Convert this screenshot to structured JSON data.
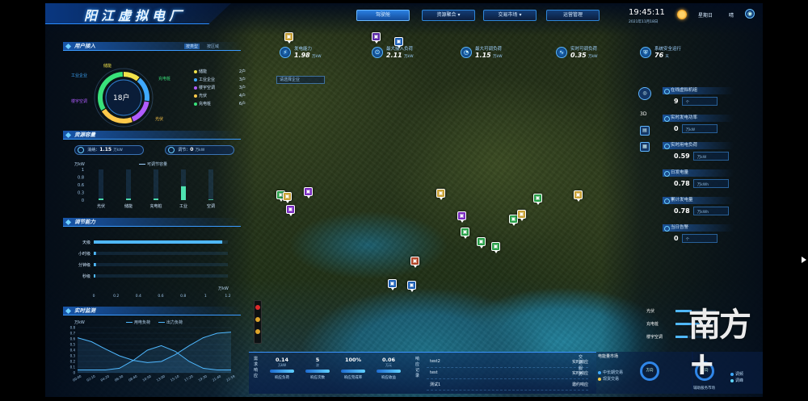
{
  "app": {
    "title": "阳江虚拟电厂"
  },
  "nav": {
    "items": [
      {
        "label": "驾驶舱",
        "active": true
      },
      {
        "label": "资源聚合 ▾",
        "active": false
      },
      {
        "label": "交易市场 ▾",
        "active": false
      },
      {
        "label": "运营管理",
        "active": false
      }
    ]
  },
  "header": {
    "time": "19:45:11",
    "date": "2021年11月18日",
    "weekday": "星期日",
    "weather": "晴",
    "weather_icon": "sun-icon",
    "user_icon": "user-icon"
  },
  "top_stats": [
    {
      "label": "发电能力",
      "value": "1.98",
      "unit": "万kW"
    },
    {
      "label": "最大接入负荷",
      "value": "2.11",
      "unit": "万kW"
    },
    {
      "label": "最大可调负荷",
      "value": "1.15",
      "unit": "万kW"
    },
    {
      "label": "实时可调负荷",
      "value": "0.35",
      "unit": "万kW"
    },
    {
      "label": "系统安全运行",
      "value": "76",
      "unit": "天"
    }
  ],
  "map_filter": {
    "placeholder": "请选择企业"
  },
  "users": {
    "title": "用户接入",
    "type_label": "按类型",
    "region_label": "按区域",
    "total": "18户",
    "ring_labels": {
      "storage": "储能",
      "industry": "工业企业",
      "charging": "充电桩",
      "hvac": "楼宇空调",
      "pv": "光伏"
    },
    "legend": [
      {
        "name": "储能",
        "count": "2户",
        "color": "#f0e24a"
      },
      {
        "name": "工业企业",
        "count": "3户",
        "color": "#3fa9ff"
      },
      {
        "name": "楼宇空调",
        "count": "3户",
        "color": "#b05cff"
      },
      {
        "name": "光伏",
        "count": "4户",
        "color": "#ffc94a"
      },
      {
        "name": "充电桩",
        "count": "6户",
        "color": "#39e27a"
      }
    ]
  },
  "resource": {
    "title": "资源容量",
    "gen_label": "消纳：",
    "gen_value": "1.15",
    "gen_unit": "万kW",
    "load_label": "调节：",
    "load_value": "0",
    "load_unit": "万kW",
    "legend": "可调节容量",
    "yunit": "万kW"
  },
  "resource_chart": {
    "type": "bar",
    "categories": [
      "光伏",
      "储能",
      "充电桩",
      "工业",
      "空调"
    ],
    "values": [
      0.05,
      0.05,
      0.05,
      0.45,
      0.02
    ],
    "yticks": [
      "1",
      "0.8",
      "0.6",
      "0.3",
      "0"
    ],
    "ylim": [
      0,
      1
    ]
  },
  "regulation": {
    "title": "调节能力",
    "unit": "万kW",
    "xticks": [
      "0",
      "0.2",
      "0.4",
      "0.6",
      "0.8",
      "1",
      "1.2"
    ]
  },
  "regulation_chart": {
    "type": "bar",
    "orientation": "horizontal",
    "categories": [
      "天级",
      "小时级",
      "分钟级",
      "秒级"
    ],
    "values": [
      1.15,
      0.02,
      0.02,
      0.01
    ],
    "xlim": [
      0,
      1.2
    ]
  },
  "monitor": {
    "title": "实时监测",
    "yunit": "万kW",
    "legend_load": "用电负荷",
    "legend_gen": "出力负荷"
  },
  "monitor_chart": {
    "type": "line",
    "x": [
      "00:00",
      "02:10",
      "04:20",
      "06:30",
      "08:40",
      "10:50",
      "13:00",
      "15:10",
      "17:20",
      "19:30",
      "21:40",
      "22:59"
    ],
    "ylim": [
      0,
      0.8
    ],
    "yticks": [
      "0.8",
      "0.7",
      "0.6",
      "0.5",
      "0.4",
      "0.3",
      "0.2",
      "0.1",
      "0"
    ],
    "series": [
      {
        "name": "用电负荷",
        "color": "#4fb8ff",
        "values": [
          0.62,
          0.55,
          0.42,
          0.3,
          0.22,
          0.18,
          0.2,
          0.32,
          0.48,
          0.62,
          0.7,
          0.72
        ]
      },
      {
        "name": "出力负荷",
        "color": "#4fb8ff",
        "values": [
          0.05,
          0.05,
          0.05,
          0.08,
          0.22,
          0.4,
          0.48,
          0.38,
          0.2,
          0.08,
          0.05,
          0.05
        ]
      }
    ]
  },
  "right_panel": {
    "items": [
      {
        "label": "在线虚拟机组",
        "value": "9",
        "unit": "个"
      },
      {
        "label": "实时发电功率",
        "value": "0",
        "unit": "万kW"
      },
      {
        "label": "实时用电负荷",
        "value": "0.59",
        "unit": "万kW"
      },
      {
        "label": "日发电量",
        "value": "0.78",
        "unit": "万kWh"
      },
      {
        "label": "累计发电量",
        "value": "0.78",
        "unit": "万kWh"
      },
      {
        "label": "当日告警",
        "value": "0",
        "unit": "个"
      }
    ],
    "tools": [
      "3D"
    ],
    "mini_bars": [
      {
        "label": "光伏",
        "value": 0.4
      },
      {
        "label": "充电桩",
        "value": 0.6
      },
      {
        "label": "楼宇空调",
        "value": 0.3
      }
    ]
  },
  "response": {
    "side_label": "需求响应",
    "metrics": [
      {
        "value": "0.14",
        "unit": "万kW",
        "label": "响应负荷"
      },
      {
        "value": "5",
        "unit": "次",
        "label": "响应次数"
      },
      {
        "value": "100%",
        "unit": "",
        "label": "响应完成率"
      },
      {
        "value": "0.06",
        "unit": "万元",
        "label": "响应收益"
      }
    ],
    "records_label": "响应记录",
    "records": [
      {
        "name": "test2",
        "status": "实时响应"
      },
      {
        "name": "test",
        "status": "实时响应"
      },
      {
        "name": "测试1",
        "status": "邀约响应"
      }
    ],
    "trade_label": "交易服务",
    "trade_title": "电能量市场",
    "trade_legend": [
      "中长期交易",
      "现货交易"
    ],
    "trade_gauge_left": "方向",
    "trade_gauge_right": "方向",
    "trade_title2": "辅助服务市场",
    "trade_legend2": [
      "调频",
      "调峰"
    ]
  },
  "watermark": {
    "text": "南方+"
  }
}
